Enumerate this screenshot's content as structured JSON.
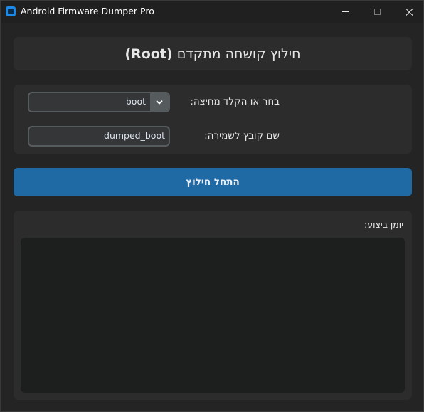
{
  "window": {
    "title": "Android Firmware Dumper Pro",
    "icon": "app-icon"
  },
  "header": {
    "title_prefix": "חילוץ קושחה מתקדם ",
    "title_bold": "(Root)"
  },
  "form": {
    "partition_label": "בחר או הקלד מחיצה:",
    "partition_value": "boot",
    "filename_label": "שם קובץ לשמירה:",
    "filename_value": "dumped_boot"
  },
  "actions": {
    "start_label": "התחל חילוץ"
  },
  "log": {
    "label": ":יומן ביצוע",
    "content": ""
  },
  "colors": {
    "accent": "#1f6aa5",
    "background": "#242424",
    "panel": "#2c2c2c",
    "input_bg": "#343638",
    "input_border": "#565b5e"
  }
}
